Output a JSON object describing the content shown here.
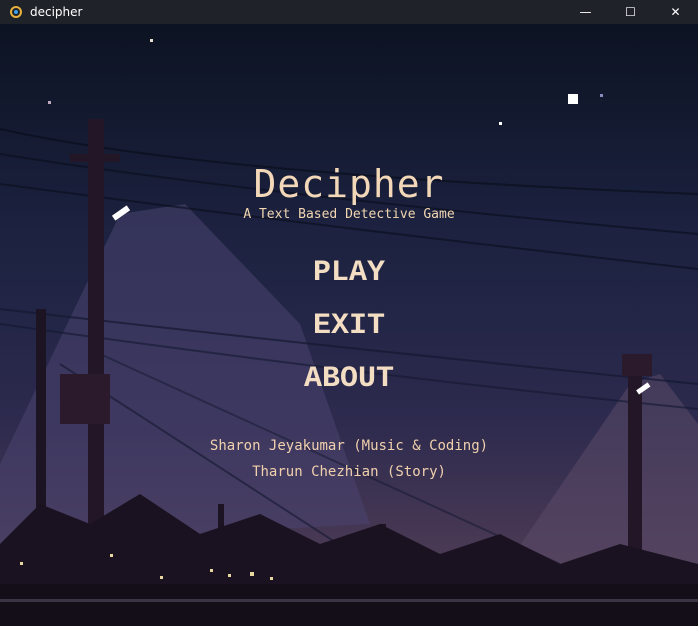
{
  "window": {
    "title": "decipher",
    "buttons": {
      "minimize": "—",
      "maximize": "☐",
      "close": "✕"
    }
  },
  "game": {
    "title": "Decipher",
    "subtitle": "A Text Based Detective Game"
  },
  "menu": {
    "play": "PLAY",
    "exit": "EXIT",
    "about": "ABOUT"
  },
  "credits": [
    "Sharon Jeyakumar (Music & Coding)",
    "Tharun Chezhian (Story)"
  ],
  "colors": {
    "titlebar": "#20222a",
    "sky_top": "#0c1322",
    "sky_mid": "#2a2a4e",
    "sky_low": "#5a4258",
    "text": "#f0d3b0"
  }
}
